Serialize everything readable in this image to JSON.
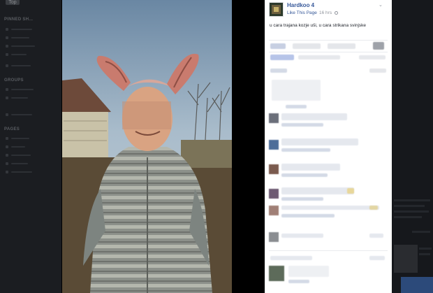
{
  "background": {
    "tab_label": "Top",
    "sections": [
      "PINNED SH...",
      "GROUPS",
      "PAGES"
    ]
  },
  "post": {
    "page_name": "Hardkoo 4",
    "like_page": "Like This Page",
    "separator": "·",
    "time": "16 hrs",
    "caption": "u cara trajana kozje uši, u cara strikana svinjske"
  },
  "colors": {
    "link": "#365899",
    "text": "#1d2129",
    "muted": "#90949c",
    "overlay": "#000000"
  }
}
